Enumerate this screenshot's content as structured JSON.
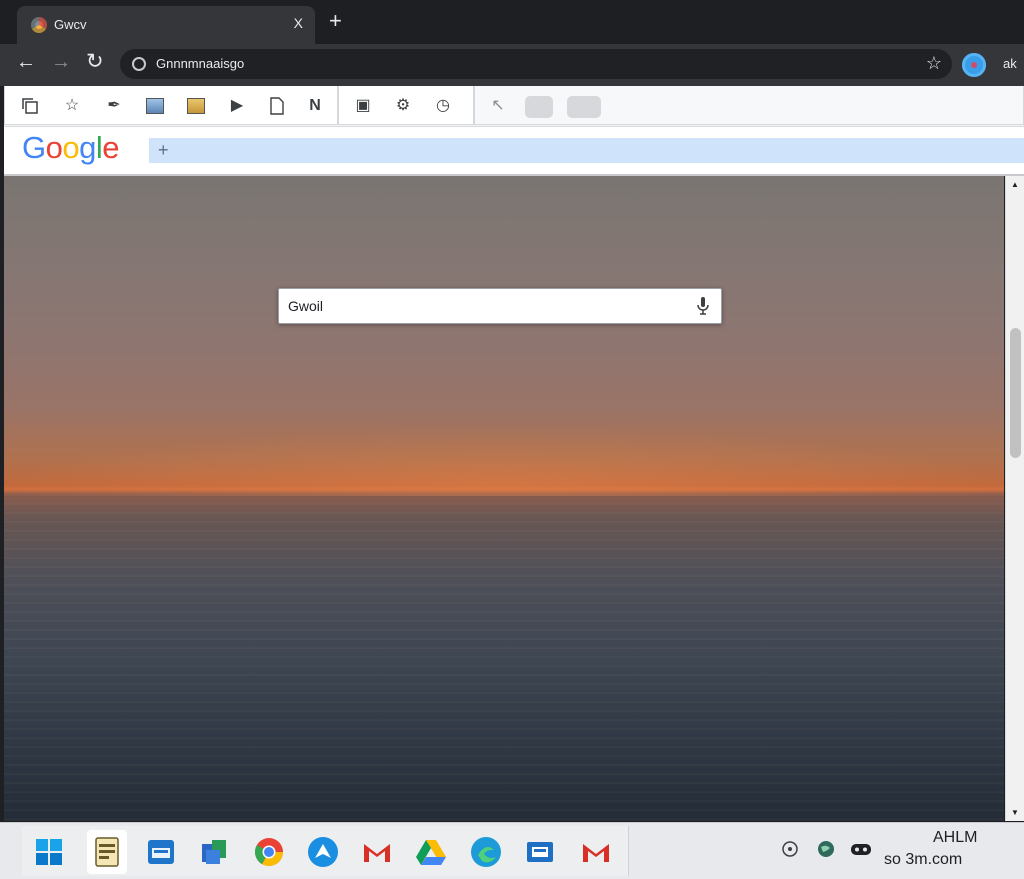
{
  "tab": {
    "title": "Gwcv",
    "close_glyph": "X"
  },
  "omnibox": {
    "url": "Gnnnmnaaisgo"
  },
  "nav": {
    "more_label": "ak"
  },
  "toolbar": {
    "letter_button": "N"
  },
  "google": {
    "logo_letters": [
      "G",
      "o",
      "o",
      "g",
      "l",
      "e"
    ],
    "logo_colors": [
      "#4285F4",
      "#EA4335",
      "#FBBC05",
      "#4285F4",
      "#34A853",
      "#EA4335"
    ]
  },
  "page": {
    "search_value": "Gwoil"
  },
  "taskbar": {
    "apps": [
      "windows-start",
      "file-explorer",
      "calendar",
      "photos",
      "chrome",
      "send",
      "gmail",
      "google-drive",
      "edge",
      "mail",
      "gmail"
    ]
  },
  "clock": {
    "time": "AHLM",
    "date": "so 3m.com"
  },
  "colors": {
    "tab_bg": "#35363a",
    "titlebar_bg": "#1e1f22",
    "omnibox_bg": "#202124",
    "google_search_bar": "#cfe3fb",
    "profile_blue": "#3a9de8"
  }
}
